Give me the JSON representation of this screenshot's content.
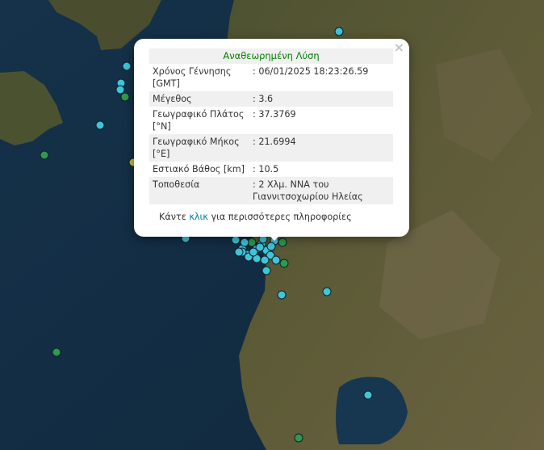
{
  "popup": {
    "title": "Αναθεωρημένη Λύση",
    "rows": [
      {
        "label": "Χρόνος Γέννησης [GMT]",
        "value": ": 06/01/2025 18:23:26.59"
      },
      {
        "label": "Μέγεθος",
        "value": ": 3.6"
      },
      {
        "label": "Γεωγραφικό Πλάτος [°N]",
        "value": ": 37.3769"
      },
      {
        "label": "Γεωγραφικό Μήκος [°E]",
        "value": ": 21.6994"
      },
      {
        "label": "Εστιακό Βάθος [km]",
        "value": ": 10.5"
      },
      {
        "label": "Τοποθεσία",
        "value": ": 2 Χλμ. ΝΝΑ του Γιαννιτσοχωρίου Ηλείας"
      }
    ],
    "more_prefix": "Κάντε ",
    "more_link": "κλικ",
    "more_suffix": " για περισσότερες πληροφορίες",
    "close_icon": "×"
  },
  "marker_colors": {
    "cyan": "#3fc5d6",
    "green": "#2e9b4a",
    "yellow": "#c8b53a"
  }
}
